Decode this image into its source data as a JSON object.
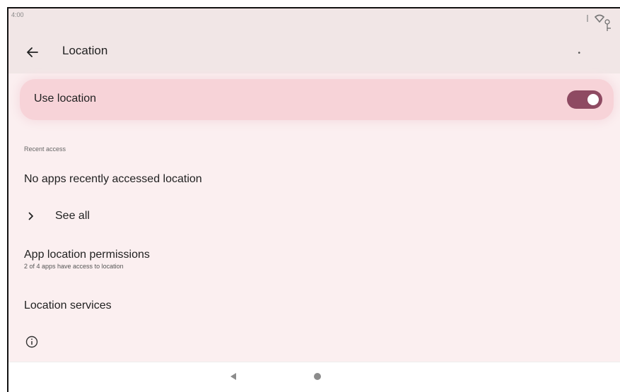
{
  "status_bar": {
    "time": "4:00",
    "icons": [
      "signal-icon",
      "wifi-icon",
      "battery-icon"
    ]
  },
  "app_bar": {
    "back_icon": "arrow-left-icon",
    "title": "Location"
  },
  "use_location": {
    "label": "Use location",
    "enabled": true
  },
  "recent_access": {
    "header": "Recent access",
    "empty_text": "No apps recently accessed location",
    "see_all_label": "See all"
  },
  "app_permissions": {
    "title": "App location permissions",
    "summary": "2 of 4 apps have access to location"
  },
  "location_services": {
    "title": "Location services"
  },
  "footer": {
    "info_icon": "info-icon"
  },
  "nav_bar": {
    "icons": [
      "back-triangle-icon",
      "home-circle-icon"
    ]
  },
  "colors": {
    "background": "#fbeff0",
    "card": "#f7d3d8",
    "switch_track": "#8e4a62",
    "header_bg": "#f1e6e6"
  }
}
